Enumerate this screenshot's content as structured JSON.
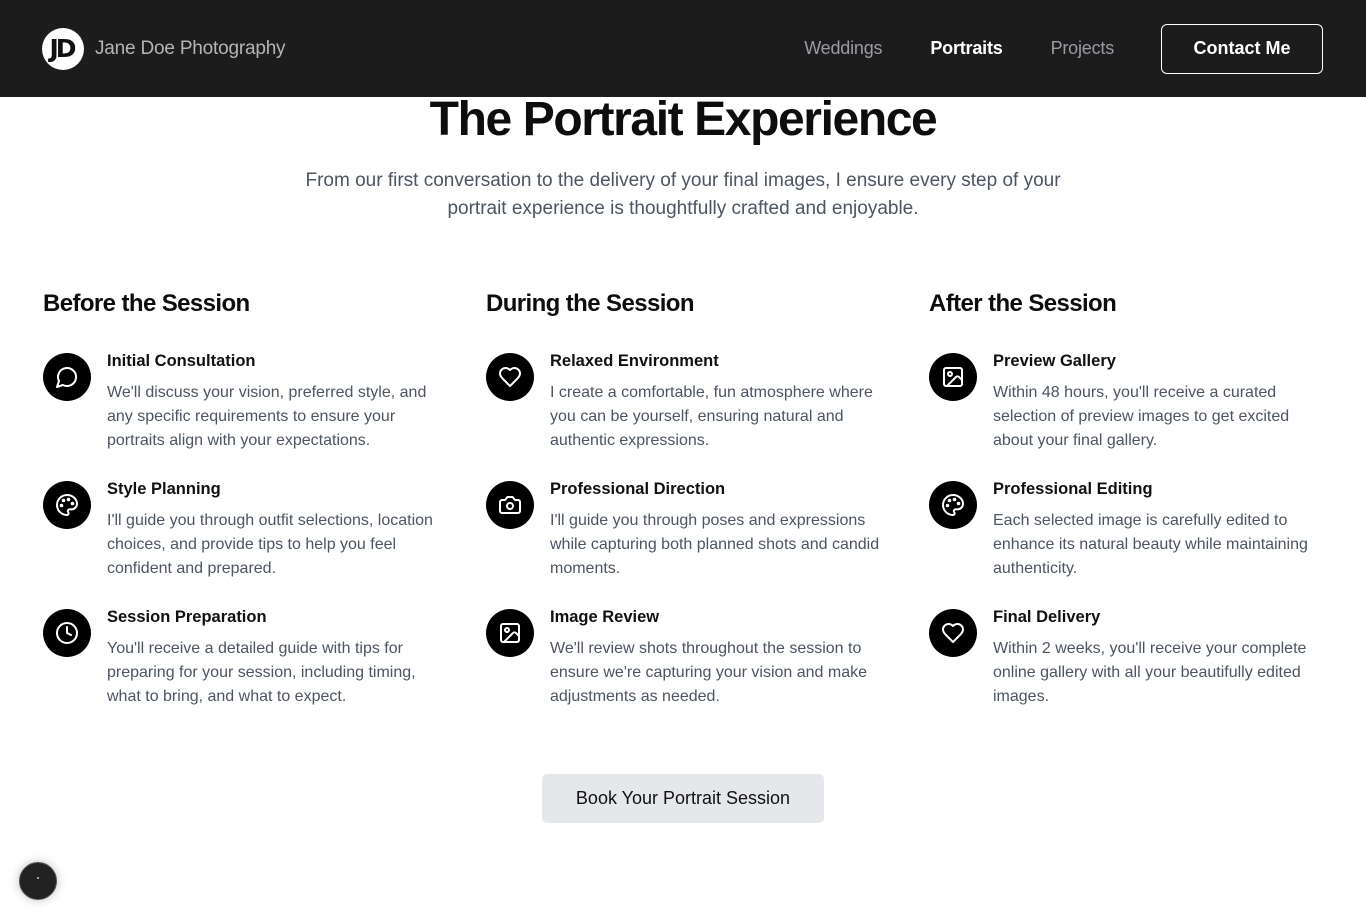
{
  "nav": {
    "logo_text": "JD",
    "brand": "Jane Doe Photography",
    "links": [
      {
        "label": "Weddings",
        "active": false
      },
      {
        "label": "Portraits",
        "active": true
      },
      {
        "label": "Projects",
        "active": false
      }
    ],
    "contact_label": "Contact Me"
  },
  "hero": {
    "title": "The Portrait Experience",
    "subtitle": "From our first conversation to the delivery of your final images, I ensure every step of your portrait experience is thoughtfully crafted and enjoyable."
  },
  "columns": [
    {
      "title": "Before the Session",
      "steps": [
        {
          "icon": "message-circle-icon",
          "title": "Initial Consultation",
          "text": "We'll discuss your vision, preferred style, and any specific requirements to ensure your portraits align with your expectations."
        },
        {
          "icon": "palette-icon",
          "title": "Style Planning",
          "text": "I'll guide you through outfit selections, location choices, and provide tips to help you feel confident and prepared."
        },
        {
          "icon": "clock-icon",
          "title": "Session Preparation",
          "text": "You'll receive a detailed guide with tips for preparing for your session, including timing, what to bring, and what to expect."
        }
      ]
    },
    {
      "title": "During the Session",
      "steps": [
        {
          "icon": "heart-icon",
          "title": "Relaxed Environment",
          "text": "I create a comfortable, fun atmosphere where you can be yourself, ensuring natural and authentic expressions."
        },
        {
          "icon": "camera-icon",
          "title": "Professional Direction",
          "text": "I'll guide you through poses and expressions while capturing both planned shots and candid moments."
        },
        {
          "icon": "image-icon",
          "title": "Image Review",
          "text": "We'll review shots throughout the session to ensure we're capturing your vision and make adjustments as needed."
        }
      ]
    },
    {
      "title": "After the Session",
      "steps": [
        {
          "icon": "image-icon",
          "title": "Preview Gallery",
          "text": "Within 48 hours, you'll receive a curated selection of preview images to get excited about your final gallery."
        },
        {
          "icon": "palette-icon",
          "title": "Professional Editing",
          "text": "Each selected image is carefully edited to enhance its natural beauty while maintaining authenticity."
        },
        {
          "icon": "heart-icon",
          "title": "Final Delivery",
          "text": "Within 2 weeks, you'll receive your complete online gallery with all your beautifully edited images."
        }
      ]
    }
  ],
  "cta": {
    "label": "Book Your Portrait Session"
  },
  "colors": {
    "header_bg": "#1c1c1c",
    "icon_bg": "#000000",
    "body_text": "#4b5563",
    "cta_bg": "#e5e7eb"
  }
}
